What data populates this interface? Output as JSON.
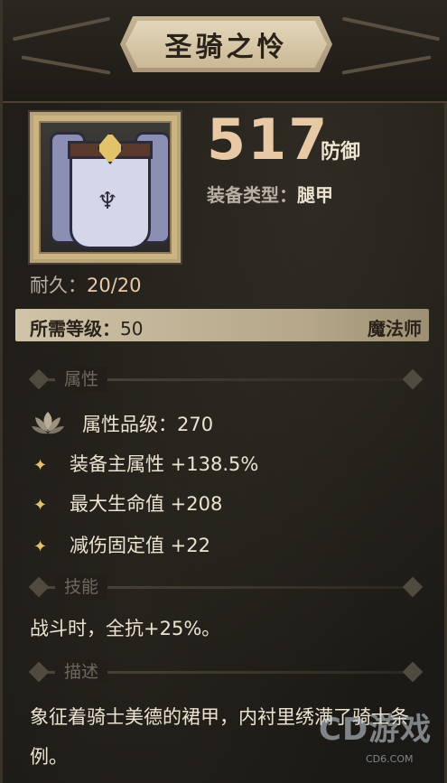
{
  "item": {
    "name": "圣骑之怜",
    "stat_value": "517",
    "stat_unit": "防御",
    "type_label": "装备类型：",
    "type_value": "腿甲",
    "durability_label": "耐久：",
    "durability_value": "20/20"
  },
  "requirement": {
    "level_label": "所需等级：",
    "level_value": "50",
    "class_value": "魔法师"
  },
  "sections": {
    "attributes": "属性",
    "skills": "技能",
    "description": "描述"
  },
  "attributes": {
    "grade_label": "属性品级：",
    "grade_value": "270",
    "lines": [
      {
        "text": "装备主属性 +138.5%"
      },
      {
        "text": "最大生命值 +208"
      },
      {
        "text": "减伤固定值 +22"
      }
    ]
  },
  "skill": {
    "text": "战斗时，全抗+25%。"
  },
  "description": {
    "text": "象征着骑士美德的裙甲，内衬里绣满了骑士条例。"
  },
  "watermark": {
    "logo": "CD游戏",
    "url": "CD6.COM"
  },
  "colors": {
    "accent_gold": "#e8c9a5",
    "star_gold": "#e2c36c",
    "requirement_bar": "#cfc3a8"
  },
  "icons": {
    "star": "sparkle-star-icon",
    "grade": "lotus-icon"
  }
}
